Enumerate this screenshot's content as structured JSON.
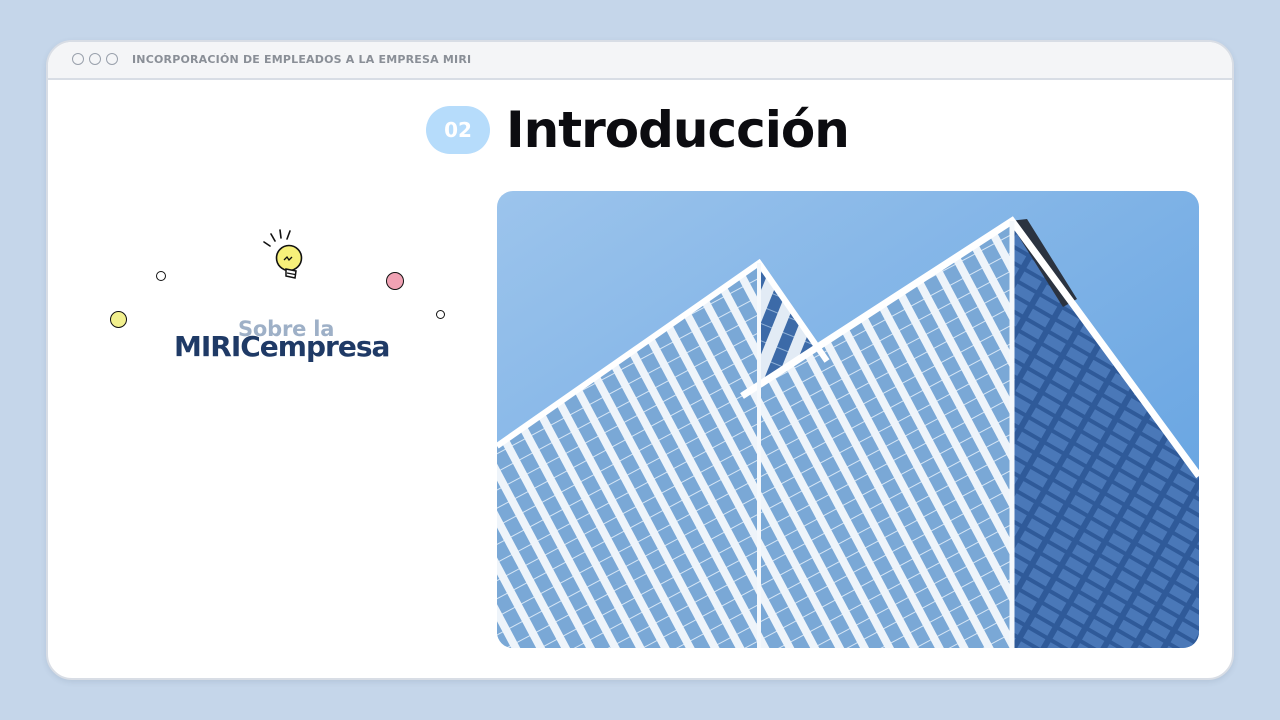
{
  "window": {
    "title": "INCORPORACIÓN DE EMPLEADOS A LA EMPRESA MIRI"
  },
  "section": {
    "number": "02",
    "title": "Introducción"
  },
  "card": {
    "subtitle": "Sobre la",
    "brand": "MIRICempresa"
  },
  "icons": {
    "lightbulb": "lightbulb-icon",
    "window_controls": "window-control-dot"
  },
  "colors": {
    "background": "#c5d6ea",
    "badge": "#b6dcfb",
    "brand": "#1f3a66",
    "subtitle": "#9eb0c7",
    "dot_yellow": "#f2f08e",
    "dot_pink": "#f0a2b4"
  }
}
